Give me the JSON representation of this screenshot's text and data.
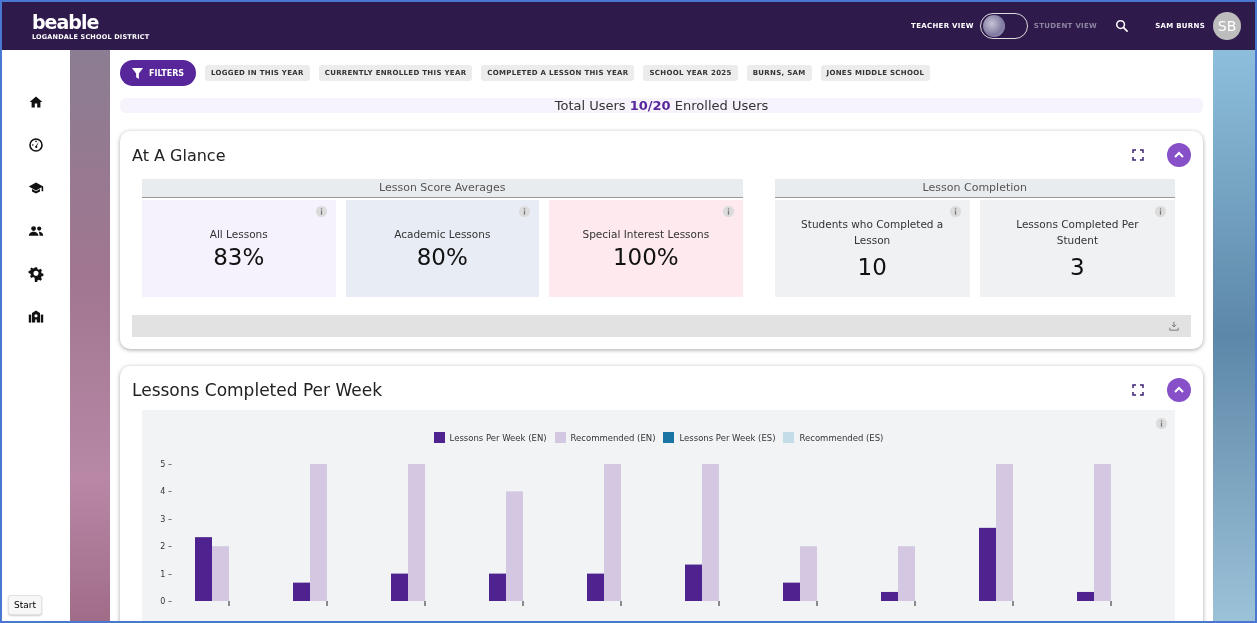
{
  "header": {
    "logo": "beable",
    "district": "LOGANDALE SCHOOL DISTRICT",
    "view_toggle": {
      "left_label": "TEACHER VIEW",
      "right_label": "STUDENT VIEW",
      "student_view": false
    },
    "user_name": "SAM BURNS",
    "avatar_initials": "SB"
  },
  "sidebar": {
    "items": [
      {
        "kind": "home"
      },
      {
        "kind": "dashboard"
      },
      {
        "kind": "school-cap"
      },
      {
        "kind": "people"
      },
      {
        "kind": "settings"
      },
      {
        "kind": "school"
      }
    ]
  },
  "filters": {
    "button": "FILTERS",
    "chips": [
      "LOGGED IN THIS YEAR",
      "CURRENTLY ENROLLED THIS YEAR",
      "COMPLETED A LESSON THIS YEAR",
      "SCHOOL YEAR 2025",
      "BURNS, SAM",
      "JONES MIDDLE SCHOOL"
    ]
  },
  "summary": "Total Users **10/20** Enrolled Users",
  "at_a_glance": {
    "title": "At A Glance",
    "groups": [
      {
        "title": "Lesson Score Averages",
        "tiles": [
          {
            "label": "All Lessons",
            "value": "83%",
            "color": "#f6f2fd"
          },
          {
            "label": "Academic Lessons",
            "value": "80%",
            "color": "#e8edf5"
          },
          {
            "label": "Special Interest Lessons",
            "value": "100%",
            "color": "#fde9ee"
          }
        ]
      },
      {
        "title": "Lesson Completion",
        "tiles": [
          {
            "label": "Students who Completed a Lesson",
            "value": "10",
            "color": "#eff1f3"
          },
          {
            "label": "Lessons Completed Per Student",
            "value": "3",
            "color": "#eff1f3"
          }
        ]
      }
    ]
  },
  "lessons_per_week": {
    "title": "Lessons Completed Per Week",
    "chart_data": {
      "type": "bar",
      "legend": "top",
      "categories": [
        null,
        null,
        null,
        null,
        null,
        null,
        null,
        null,
        null,
        null
      ],
      "yticks": [
        {
          "value": 0,
          "label": "0 –"
        },
        {
          "value": 1,
          "label": "1 –"
        },
        {
          "value": 2,
          "label": "2 –"
        },
        {
          "value": 3,
          "label": "3 –"
        },
        {
          "value": 4,
          "label": "4 –"
        },
        {
          "value": 5,
          "label": "5 –"
        }
      ],
      "ylim": [
        0,
        5
      ],
      "series": [
        {
          "name": "Lessons Per Week (EN)",
          "color": "#4e2390",
          "values": [
            2.33,
            0.67,
            1,
            1,
            1,
            1.33,
            0.67,
            0.33,
            2.67,
            0.33
          ]
        },
        {
          "name": "Recommended (EN)",
          "color": "#d3c7e2",
          "values": [
            2,
            5,
            5,
            4,
            5,
            5,
            2,
            2,
            5,
            5
          ]
        }
      ]
    },
    "empty_legend_items": [
      {
        "name": "Lessons Per Week (ES)",
        "color": "#1a75a5"
      },
      {
        "name": "Recommended (ES)",
        "color": "#c2dde8"
      }
    ]
  },
  "taskbar": {
    "start_button": "Start"
  }
}
